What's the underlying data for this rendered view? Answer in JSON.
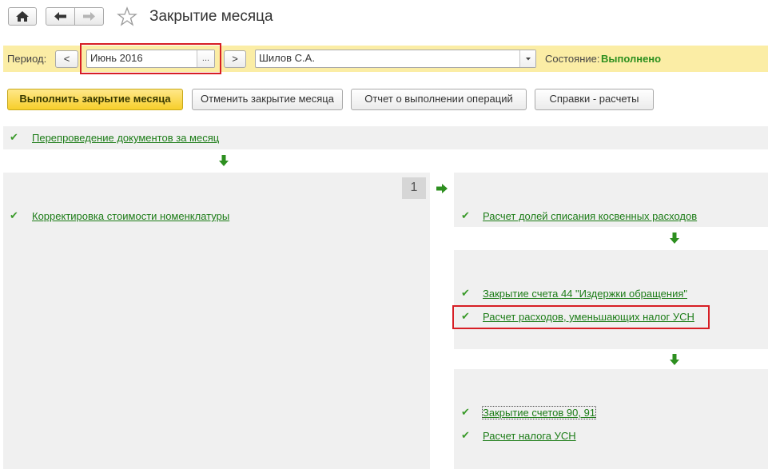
{
  "header": {
    "title": "Закрытие месяца"
  },
  "period_bar": {
    "period_label": "Период:",
    "prev": "<",
    "next": ">",
    "period_value": "Июнь 2016",
    "period_select": "...",
    "organization_value": "Шилов С.А.",
    "state_label": "Состояние:",
    "state_value": "Выполнено"
  },
  "actions": {
    "run": "Выполнить закрытие месяца",
    "cancel": "Отменить закрытие месяца",
    "report": "Отчет о выполнении операций",
    "calc": "Справки - расчеты"
  },
  "steps": {
    "repost": "Перепроведение документов за месяц",
    "cost_adjust": "Корректировка стоимости номенклатуры",
    "stage_number": "1",
    "indirect_shares": "Расчет долей списания косвенных расходов",
    "close_44": "Закрытие счета 44 \"Издержки обращения\"",
    "usn_expenses": "Расчет расходов, уменьшающих налог УСН",
    "close_90_91": "Закрытие счетов 90, 91",
    "usn_tax": "Расчет налога УСН"
  },
  "colors": {
    "accent_green": "#2d8f1f",
    "link_green": "#1c7c17",
    "bar_yellow": "#fbeda5",
    "highlight_red": "#d71e25",
    "panel_gray": "#f0f0f0"
  },
  "icons": [
    "home-icon",
    "arrow-left-icon",
    "arrow-right-icon",
    "star-icon",
    "chevron-down-icon",
    "check-icon",
    "arrow-down-icon"
  ]
}
